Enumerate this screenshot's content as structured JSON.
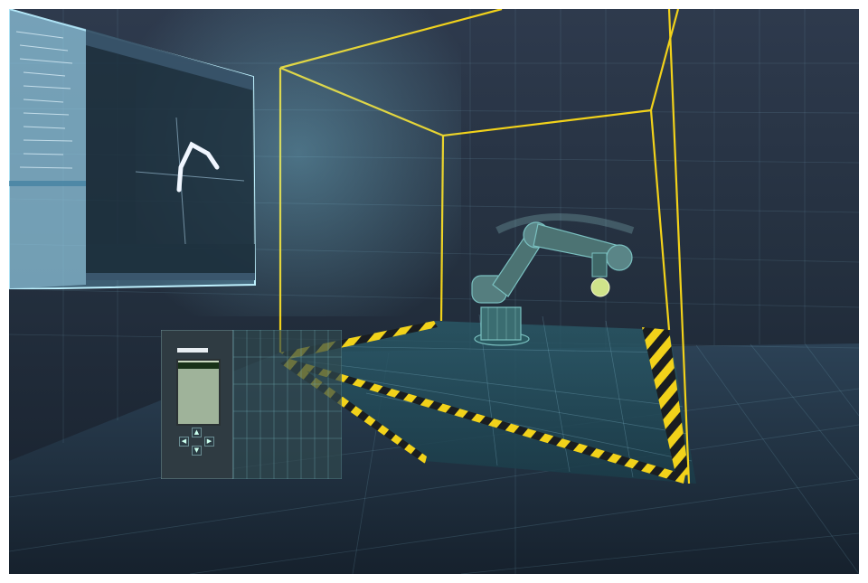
{
  "scene": {
    "background_top": "#2e3a4d",
    "background_bottom": "#17202c",
    "grid_color": "#7fb4c8",
    "cage_color": "#f2d21a",
    "hazard_stripe_colors": [
      "#f2d21a",
      "#1a1d20"
    ],
    "robot_color": "#7ac0c0",
    "robot_tool_color": "#cfe38a"
  },
  "projected_screen": {
    "glow_color": "#8fe6ff",
    "icon": "engineering-software-window",
    "tabs": [
      "",
      "",
      ""
    ],
    "status_bar_text": ""
  },
  "plc": {
    "brand_label": "",
    "lcd_lines": [
      "",
      "",
      "",
      "",
      ""
    ],
    "nav_buttons": [
      "▲",
      "◀",
      "▶",
      "▼"
    ],
    "icon": "plc-controller"
  }
}
